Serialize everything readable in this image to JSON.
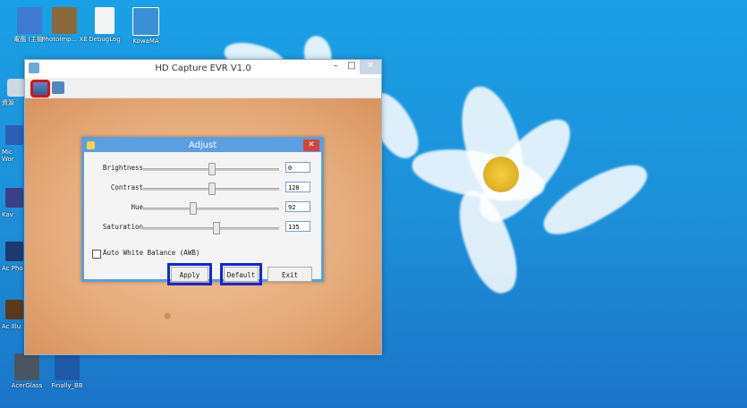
{
  "desktop": {
    "icons": [
      {
        "label": "電腦 (主機)",
        "color": "#3c7bd1"
      },
      {
        "label": "PhotoImp... XE",
        "color": "#8a6a3c"
      },
      {
        "label": "DebugLog",
        "color": "#e8e8e8"
      },
      {
        "label": "KowaMA",
        "color": "#3a8fd6"
      }
    ],
    "bottom_icons": [
      {
        "label": "AcerGlass",
        "color": "#4a5562"
      },
      {
        "label": "Finally_BB",
        "color": "#1e5aa8"
      }
    ],
    "left_labels": [
      "資源",
      "Mic Wor",
      "Kav",
      "Ac Pho",
      "Ac Illu"
    ]
  },
  "window": {
    "title": "HD Capture EVR V1.0",
    "controls": {
      "min": "–",
      "max": "□",
      "close": "✕"
    }
  },
  "dialog": {
    "title": "Adjust",
    "close": "✕",
    "rows": [
      {
        "label": "Brightness",
        "value": "0",
        "level": 0.5
      },
      {
        "label": "Contrast",
        "value": "128",
        "level": 0.5
      },
      {
        "label": "Hue",
        "value": "92",
        "level": 0.36
      },
      {
        "label": "Saturation",
        "value": "135",
        "level": 0.53
      }
    ],
    "awb_label": "Auto White Balance (AWB)",
    "awb_checked": false,
    "buttons": {
      "apply": "Apply",
      "default": "Default",
      "exit": "Exit"
    }
  }
}
